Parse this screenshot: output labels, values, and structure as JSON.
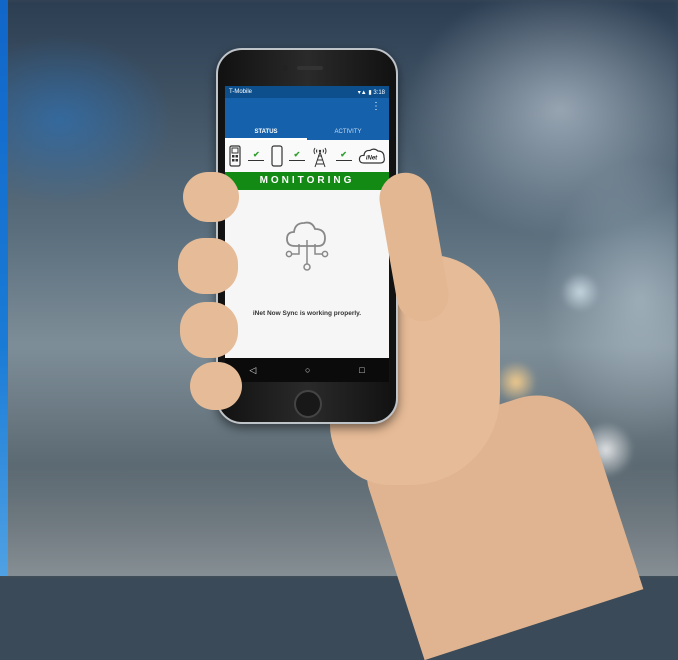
{
  "phone": {
    "status_bar": {
      "carrier": "T-Mobile",
      "time": "3:18"
    },
    "tabs": [
      {
        "label": "STATUS",
        "active": true
      },
      {
        "label": "ACTIVITY",
        "active": false
      }
    ],
    "menu_icon": "overflow-menu-icon",
    "chain": [
      "gas-detector-icon",
      "smartphone-icon",
      "cell-tower-icon",
      "inet-cloud-icon"
    ],
    "chain_cloud_label": "iNet",
    "banner": "MONITORING",
    "message": "iNet Now Sync is working properly.",
    "nav": [
      {
        "icon": "back-icon",
        "glyph": "◁"
      },
      {
        "icon": "home-icon",
        "glyph": "○"
      },
      {
        "icon": "recents-icon",
        "glyph": "□"
      }
    ],
    "colors": {
      "app_bar": "#1561ac",
      "banner": "#138a13",
      "check": "#2ea02e"
    }
  }
}
